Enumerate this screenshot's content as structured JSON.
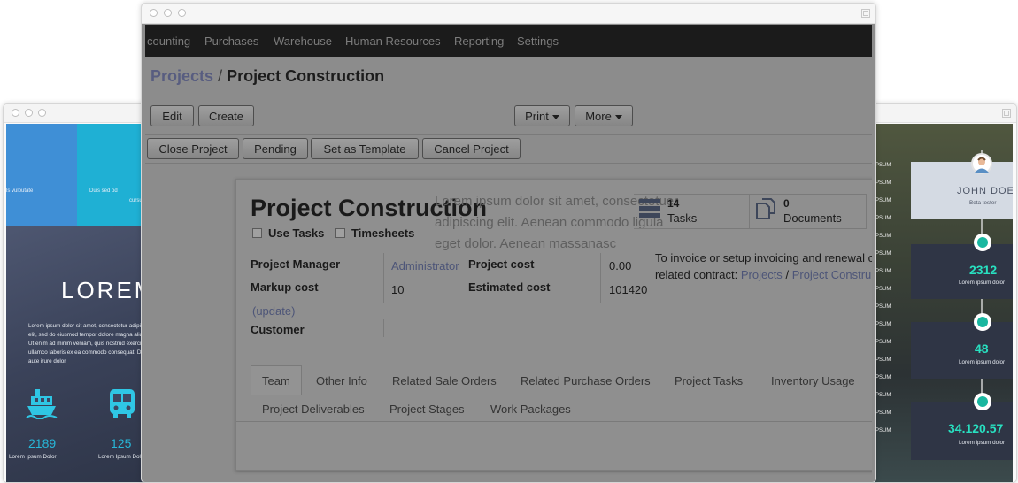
{
  "left_window": {
    "top_left_text": "ls vulputate",
    "top_right_text_1": "Duis sed od",
    "top_right_text_2": "cursu",
    "lorem_heading": "LOREM",
    "paragraph": "Lorem ipsum dolor sit amet, consectetur adipiscing elit, sed do eiusmod tempor dolore magna aliqua. Ut enim ad minim veniam, quis nostrud exercitation ullamco laboris ex ea commodo consequat. Duis aute irure dolor",
    "stats": [
      {
        "icon": "ship-icon",
        "value": "2189",
        "caption": "Lorem Ipsum Dolor"
      },
      {
        "icon": "bus-icon",
        "value": "125",
        "caption": "Lorem Ipsum Dolor"
      }
    ]
  },
  "right_window": {
    "menu_items": [
      "PSUM",
      "PSUM",
      "PSUM",
      "PSUM",
      "PSUM",
      "PSUM",
      "PSUM",
      "PSUM",
      "PSUM",
      "PSUM",
      "PSUM",
      "PSUM",
      "PSUM",
      "PSUM",
      "PSUM",
      "PSUM"
    ],
    "profile_name": "JOHN DOE",
    "profile_role": "Beta tester",
    "stats": [
      {
        "icon": "shield-icon",
        "value": "2312",
        "caption": "Lorem ipsum dolor"
      },
      {
        "icon": "dice-icon",
        "value": "48",
        "caption": "Lorem ipsum dolor"
      },
      {
        "icon": "camera-icon",
        "value": "34.120.57",
        "caption": "Lorem ipsum dolor"
      }
    ]
  },
  "main_window": {
    "nav": [
      "counting",
      "Purchases",
      "Warehouse",
      "Human Resources",
      "Reporting",
      "Settings"
    ],
    "breadcrumb": {
      "parent": "Projects",
      "separator": "/",
      "current": "Project Construction"
    },
    "toolbar": {
      "edit": "Edit",
      "create": "Create",
      "print": "Print",
      "more": "More"
    },
    "actions": {
      "close_project": "Close Project",
      "pending": "Pending",
      "set_as_template": "Set as Template",
      "cancel_project": "Cancel Project"
    },
    "form": {
      "title": "Project Construction",
      "lorem_overlay": "Lorem ipsum dolor sit amet, consectetuer adipiscing elit. Aenean commodo ligula eget dolor. Aenean massanasc",
      "use_tasks": "Use Tasks",
      "timesheets": "Timesheets",
      "stats": {
        "tasks_count": "14",
        "tasks_label": "Tasks",
        "documents_count": "0",
        "documents_label": "Documents"
      },
      "project_manager_label": "Project Manager",
      "project_manager_value": "Administrator",
      "markup_cost_label": "Markup cost",
      "markup_cost_value": "10",
      "update_link": "(update)",
      "customer_label": "Customer",
      "project_cost_label": "Project cost",
      "project_cost_value": "0.00",
      "estimated_cost_label": "Estimated cost",
      "estimated_cost_value": "101420",
      "invoice_text": "To invoice or setup invoicing and renewal c",
      "invoice_related": "related contract:",
      "invoice_link_projects": "Projects",
      "invoice_link_sep": "/",
      "invoice_link_project": "Project Constru"
    },
    "tabs_row1": [
      "Team",
      "Other Info",
      "Related Sale Orders",
      "Related Purchase Orders",
      "Project Tasks",
      "Inventory Usage"
    ],
    "tabs_row2": [
      "Project Deliverables",
      "Project Stages",
      "Work Packages"
    ]
  }
}
